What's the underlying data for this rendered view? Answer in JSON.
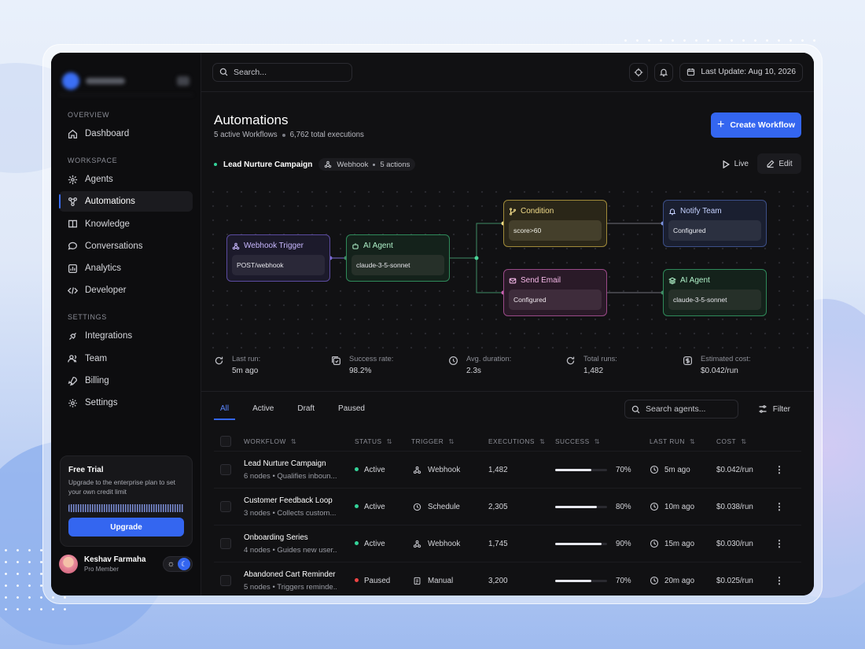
{
  "sidebar": {
    "sections": [
      {
        "label": "OVERVIEW",
        "items": [
          {
            "label": "Dashboard",
            "icon": "home-icon"
          }
        ]
      },
      {
        "label": "WORKSPACE",
        "items": [
          {
            "label": "Agents",
            "icon": "agents-icon"
          },
          {
            "label": "Automations",
            "icon": "automations-icon",
            "active": true
          },
          {
            "label": "Knowledge",
            "icon": "book-icon"
          },
          {
            "label": "Conversations",
            "icon": "chat-icon"
          },
          {
            "label": "Analytics",
            "icon": "chart-icon"
          },
          {
            "label": "Developer",
            "icon": "code-icon"
          }
        ]
      },
      {
        "label": "SETTINGS",
        "items": [
          {
            "label": "Integrations",
            "icon": "plug-icon"
          },
          {
            "label": "Team",
            "icon": "team-icon"
          },
          {
            "label": "Billing",
            "icon": "rocket-icon"
          },
          {
            "label": "Settings",
            "icon": "gear-icon"
          }
        ]
      }
    ],
    "trial": {
      "title": "Free Trial",
      "text": "Upgrade to the enterprise plan to set your own credit limit",
      "button": "Upgrade"
    },
    "user": {
      "name": "Keshav Farmaha",
      "role": "Pro Member"
    }
  },
  "topbar": {
    "search_placeholder": "Search...",
    "last_update": "Last Update: Aug 10, 2026"
  },
  "page": {
    "title": "Automations",
    "active_workflows": "5 active Workflows",
    "total_executions": "6,762 total executions",
    "create_button": "Create Workflow"
  },
  "workflow": {
    "name": "Lead Nurture Campaign",
    "trigger": "Webhook",
    "actions": "5 actions",
    "live_label": "Live",
    "edit_label": "Edit",
    "nodes": {
      "webhook": {
        "title": "Webhook Trigger",
        "value": "POST/webhook"
      },
      "agent1": {
        "title": "AI Agent",
        "value": "claude-3-5-sonnet"
      },
      "condition": {
        "title": "Condition",
        "value": "score>60"
      },
      "email": {
        "title": "Send Email",
        "value": "Configured"
      },
      "notify": {
        "title": "Notify Team",
        "value": "Configured"
      },
      "agent2": {
        "title": "AI Agent",
        "value": "claude-3-5-sonnet"
      }
    },
    "stats": [
      {
        "label": "Last run:",
        "value": "5m ago"
      },
      {
        "label": "Success rate:",
        "value": "98.2%"
      },
      {
        "label": "Avg. duration:",
        "value": "2.3s"
      },
      {
        "label": "Total runs:",
        "value": "1,482"
      },
      {
        "label": "Estimated cost:",
        "value": "$0.042/run"
      }
    ]
  },
  "tabs": [
    "All",
    "Active",
    "Draft",
    "Paused"
  ],
  "agent_search_placeholder": "Search agents...",
  "filter_label": "Filter",
  "table": {
    "headers": [
      "WORKFLOW",
      "STATUS",
      "TRIGGER",
      "EXECUTIONS",
      "SUCCESS",
      "LAST RUN",
      "COST"
    ],
    "rows": [
      {
        "name": "Lead Nurture Campaign",
        "desc": "6 nodes • Qualifies inboun...",
        "status": "Active",
        "status_color": "#34d399",
        "trigger": "Webhook",
        "trigger_icon": "webhook-icon",
        "executions": "1,482",
        "success": "70%",
        "success_frac": 0.7,
        "last_run": "5m ago",
        "cost": "$0.042/run"
      },
      {
        "name": "Customer Feedback Loop",
        "desc": "3 nodes • Collects custom...",
        "status": "Active",
        "status_color": "#34d399",
        "trigger": "Schedule",
        "trigger_icon": "clock-icon",
        "executions": "2,305",
        "success": "80%",
        "success_frac": 0.8,
        "last_run": "10m ago",
        "cost": "$0.038/run"
      },
      {
        "name": "Onboarding Series",
        "desc": "4 nodes • Guides new user...",
        "status": "Active",
        "status_color": "#34d399",
        "trigger": "Webhook",
        "trigger_icon": "webhook-icon",
        "executions": "1,745",
        "success": "90%",
        "success_frac": 0.9,
        "last_run": "15m ago",
        "cost": "$0.030/run"
      },
      {
        "name": "Abandoned Cart Reminder",
        "desc": "5 nodes • Triggers reminde...",
        "status": "Paused",
        "status_color": "#ef4444",
        "trigger": "Manual",
        "trigger_icon": "document-icon",
        "executions": "3,200",
        "success": "70%",
        "success_frac": 0.7,
        "last_run": "20m ago",
        "cost": "$0.025/run"
      }
    ]
  },
  "colors": {
    "accent": "#3466f0",
    "active": "#34d399",
    "paused": "#ef4444"
  }
}
